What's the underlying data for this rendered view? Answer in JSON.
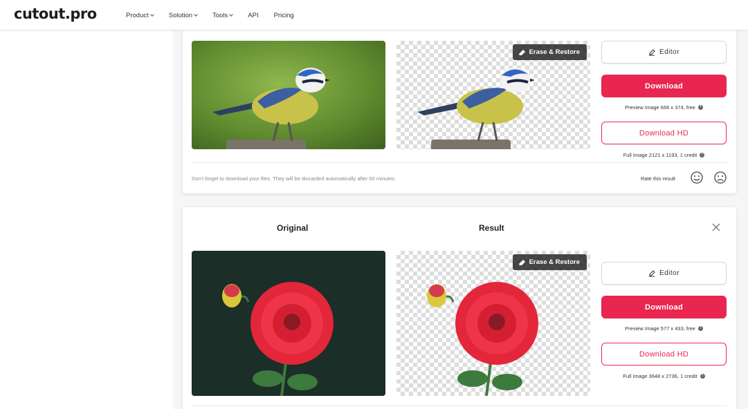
{
  "header": {
    "logo": "cutout.pro",
    "nav": [
      {
        "label": "Product",
        "has_dropdown": true
      },
      {
        "label": "Solution",
        "has_dropdown": true
      },
      {
        "label": "Tools",
        "has_dropdown": true
      },
      {
        "label": "API",
        "has_dropdown": false
      },
      {
        "label": "Pricing",
        "has_dropdown": false
      }
    ]
  },
  "cards": [
    {
      "erase_label": "Erase & Restore",
      "editor_label": "Editor",
      "download_label": "Download",
      "preview_info": "Preview Image 666 x 374, free",
      "download_hd_label": "Download HD",
      "full_info": "Full Image 2121 x 1193, 1 credit",
      "footer_note": "Don't forget to download your files. They will be discarded automatically after 60 minutes.",
      "rate_label": "Rate this result"
    },
    {
      "original_title": "Original",
      "result_title": "Result",
      "erase_label": "Erase & Restore",
      "editor_label": "Editor",
      "download_label": "Download",
      "preview_info": "Preview Image 577 x 433, free",
      "download_hd_label": "Download HD",
      "full_info": "Full Image 3648 x 2736, 1 credit"
    }
  ],
  "colors": {
    "accent": "#e8264f",
    "bird_bg": "#6f9a3a",
    "flower_bg": "#1b2e27"
  },
  "info_glyph": "!"
}
